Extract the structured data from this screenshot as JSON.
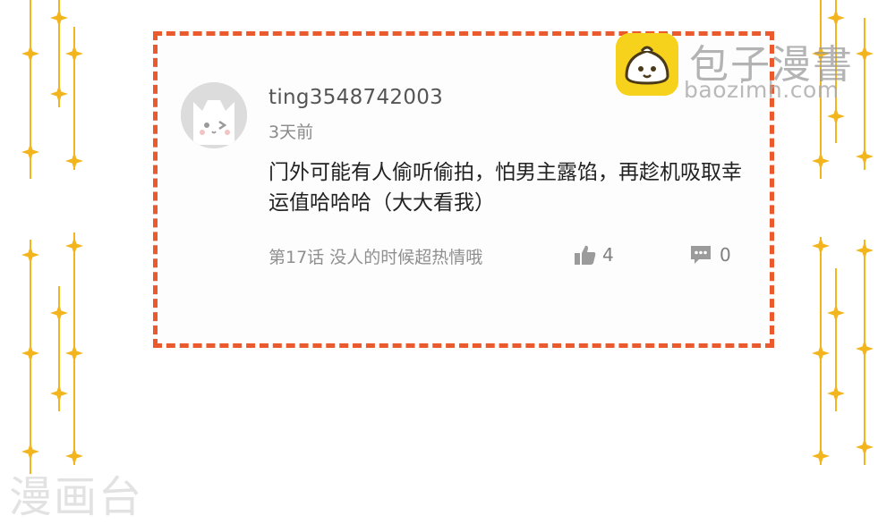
{
  "comment": {
    "username": "ting3548742003",
    "time": "3天前",
    "text": "门外可能有人偷听偷拍，怕男主露馅，再趁机吸取幸运值哈哈哈（大大看我）",
    "chapter": "第17话 没人的时候超热情哦",
    "likes": "4",
    "replies": "0",
    "avatar_icon": "cat-avatar-icon",
    "like_icon": "thumbs-up-icon",
    "reply_icon": "speech-bubble-icon"
  },
  "brand": {
    "name": "包子漫書",
    "url": "baozimh.com",
    "logo_icon": "baozi-logo-icon"
  },
  "watermark": "漫画台",
  "colors": {
    "border_dashed": "#ea5a2c",
    "sparkle": "#f3b51d",
    "logo_bg": "#f7d21c",
    "text_primary": "#222222",
    "text_secondary": "#8a8a8a"
  }
}
